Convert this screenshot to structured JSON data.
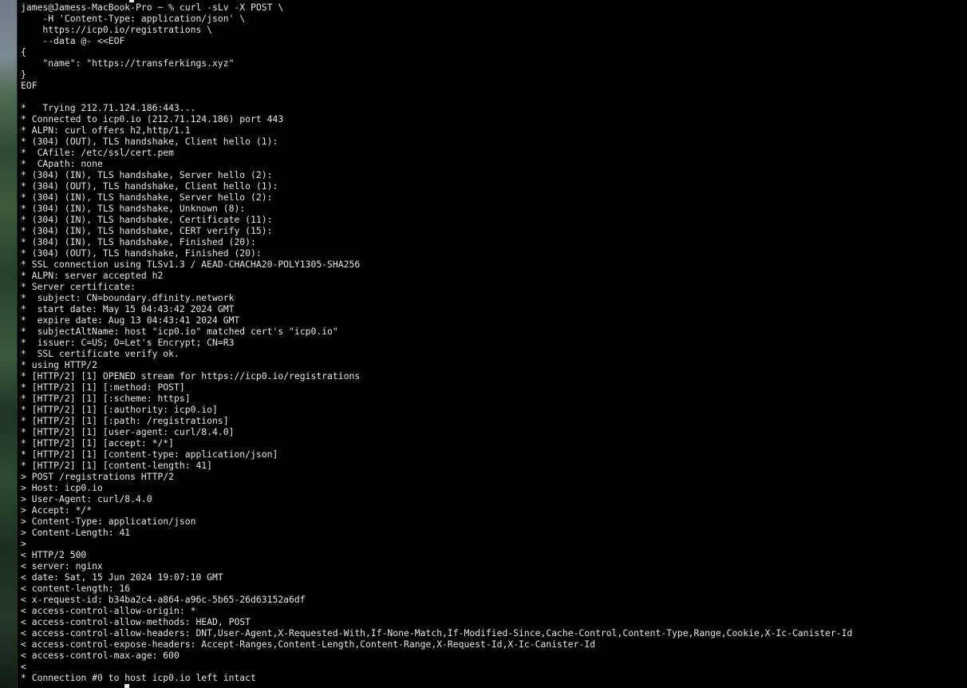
{
  "terminal": {
    "lines": [
      "james@Jamess-MacBook-Pro ~ % curl -sLv -X POST \\",
      "    -H 'Content-Type: application/json' \\",
      "    https://icp0.io/registrations \\",
      "    --data @- <<EOF",
      "{",
      "    \"name\": \"https://transferkings.xyz\"",
      "}",
      "EOF",
      "",
      "*   Trying 212.71.124.186:443...",
      "* Connected to icp0.io (212.71.124.186) port 443",
      "* ALPN: curl offers h2,http/1.1",
      "* (304) (OUT), TLS handshake, Client hello (1):",
      "*  CAfile: /etc/ssl/cert.pem",
      "*  CApath: none",
      "* (304) (IN), TLS handshake, Server hello (2):",
      "* (304) (OUT), TLS handshake, Client hello (1):",
      "* (304) (IN), TLS handshake, Server hello (2):",
      "* (304) (IN), TLS handshake, Unknown (8):",
      "* (304) (IN), TLS handshake, Certificate (11):",
      "* (304) (IN), TLS handshake, CERT verify (15):",
      "* (304) (IN), TLS handshake, Finished (20):",
      "* (304) (OUT), TLS handshake, Finished (20):",
      "* SSL connection using TLSv1.3 / AEAD-CHACHA20-POLY1305-SHA256",
      "* ALPN: server accepted h2",
      "* Server certificate:",
      "*  subject: CN=boundary.dfinity.network",
      "*  start date: May 15 04:43:42 2024 GMT",
      "*  expire date: Aug 13 04:43:41 2024 GMT",
      "*  subjectAltName: host \"icp0.io\" matched cert's \"icp0.io\"",
      "*  issuer: C=US; O=Let's Encrypt; CN=R3",
      "*  SSL certificate verify ok.",
      "* using HTTP/2",
      "* [HTTP/2] [1] OPENED stream for https://icp0.io/registrations",
      "* [HTTP/2] [1] [:method: POST]",
      "* [HTTP/2] [1] [:scheme: https]",
      "* [HTTP/2] [1] [:authority: icp0.io]",
      "* [HTTP/2] [1] [:path: /registrations]",
      "* [HTTP/2] [1] [user-agent: curl/8.4.0]",
      "* [HTTP/2] [1] [accept: */*]",
      "* [HTTP/2] [1] [content-type: application/json]",
      "* [HTTP/2] [1] [content-length: 41]",
      "> POST /registrations HTTP/2",
      "> Host: icp0.io",
      "> User-Agent: curl/8.4.0",
      "> Accept: */*",
      "> Content-Type: application/json",
      "> Content-Length: 41",
      ">",
      "< HTTP/2 500",
      "< server: nginx",
      "< date: Sat, 15 Jun 2024 19:07:10 GMT",
      "< content-length: 16",
      "< x-request-id: b34ba2c4-a864-a96c-5b65-26d63152a6df",
      "< access-control-allow-origin: *",
      "< access-control-allow-methods: HEAD, POST",
      "< access-control-allow-headers: DNT,User-Agent,X-Requested-With,If-None-Match,If-Modified-Since,Cache-Control,Content-Type,Range,Cookie,X-Ic-Canister-Id",
      "< access-control-expose-headers: Accept-Ranges,Content-Length,Content-Range,X-Request-Id,X-Ic-Canister-Id",
      "< access-control-max-age: 600",
      "<",
      "* Connection #0 to host icp0.io left intact"
    ]
  },
  "colors": {
    "background": "#000000",
    "foreground": "#e6e6e6"
  }
}
